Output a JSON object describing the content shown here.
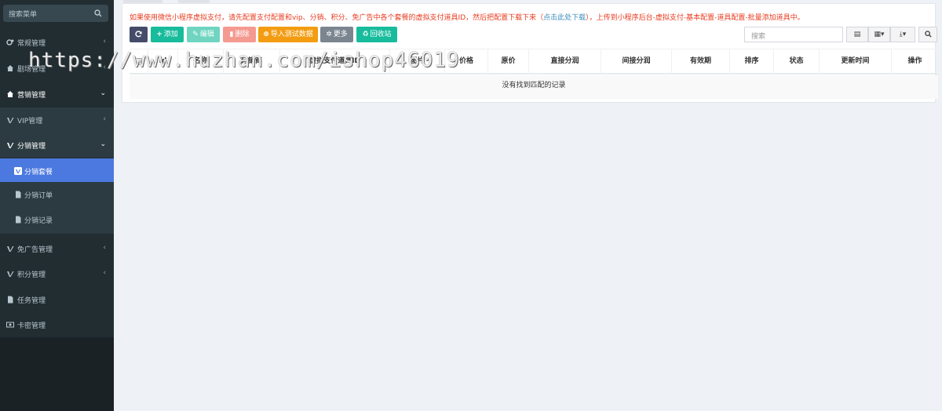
{
  "sidebar": {
    "search_placeholder": "搜索菜单",
    "items": [
      {
        "label": "常规管理",
        "arrow": "‹"
      },
      {
        "label": "剧场管理",
        "arrow": "‹"
      },
      {
        "label": "营销管理",
        "arrow": "⌄"
      },
      {
        "label": "VIP管理",
        "arrow": "‹"
      },
      {
        "label": "分销管理",
        "arrow": "⌄"
      },
      {
        "label": "分销套餐"
      },
      {
        "label": "分销订单"
      },
      {
        "label": "分销记录"
      },
      {
        "label": "免广告管理",
        "arrow": "‹"
      },
      {
        "label": "积分管理",
        "arrow": "‹"
      },
      {
        "label": "任务管理"
      },
      {
        "label": "卡密管理"
      }
    ]
  },
  "notice": {
    "text_before": "如果使用微信小程序虚拟支付，请先配置支付配置和vip、分销、积分、免广告中各个套餐的虚拟支付道具ID，然后把配置下载下来（",
    "link": "点击此处下载",
    "text_after": "），上传到小程序后台-虚拟支付-基本配置-道具配置-批量添加道具中。"
  },
  "toolbar": {
    "add": "添加",
    "edit": "编辑",
    "delete": "删除",
    "import": "导入测试数据",
    "more": "更多",
    "recycle": "回收站",
    "search_placeholder": "搜索"
  },
  "table": {
    "columns": [
      "",
      "Id",
      "名称",
      "分销商",
      "虚拟支付道具ID",
      "图片",
      "价格",
      "原价",
      "直接分润",
      "间接分润",
      "有效期",
      "排序",
      "状态",
      "更新时间",
      "操作"
    ],
    "empty_text": "没有找到匹配的记录"
  },
  "watermark": "https://www.huzhan.com/ishop46019",
  "colors": {
    "sidebar_bg": "#222d32",
    "active_bg": "#4c79e0",
    "notice": "#e83b1f",
    "link": "#3c8dbc",
    "btn_refresh": "#444c69",
    "btn_add": "#18bc9c",
    "btn_edit": "#6fd5c1",
    "btn_delete": "#f59a91",
    "btn_import": "#f39c12",
    "btn_more": "#7b8590",
    "btn_recycle": "#18bc9c"
  }
}
